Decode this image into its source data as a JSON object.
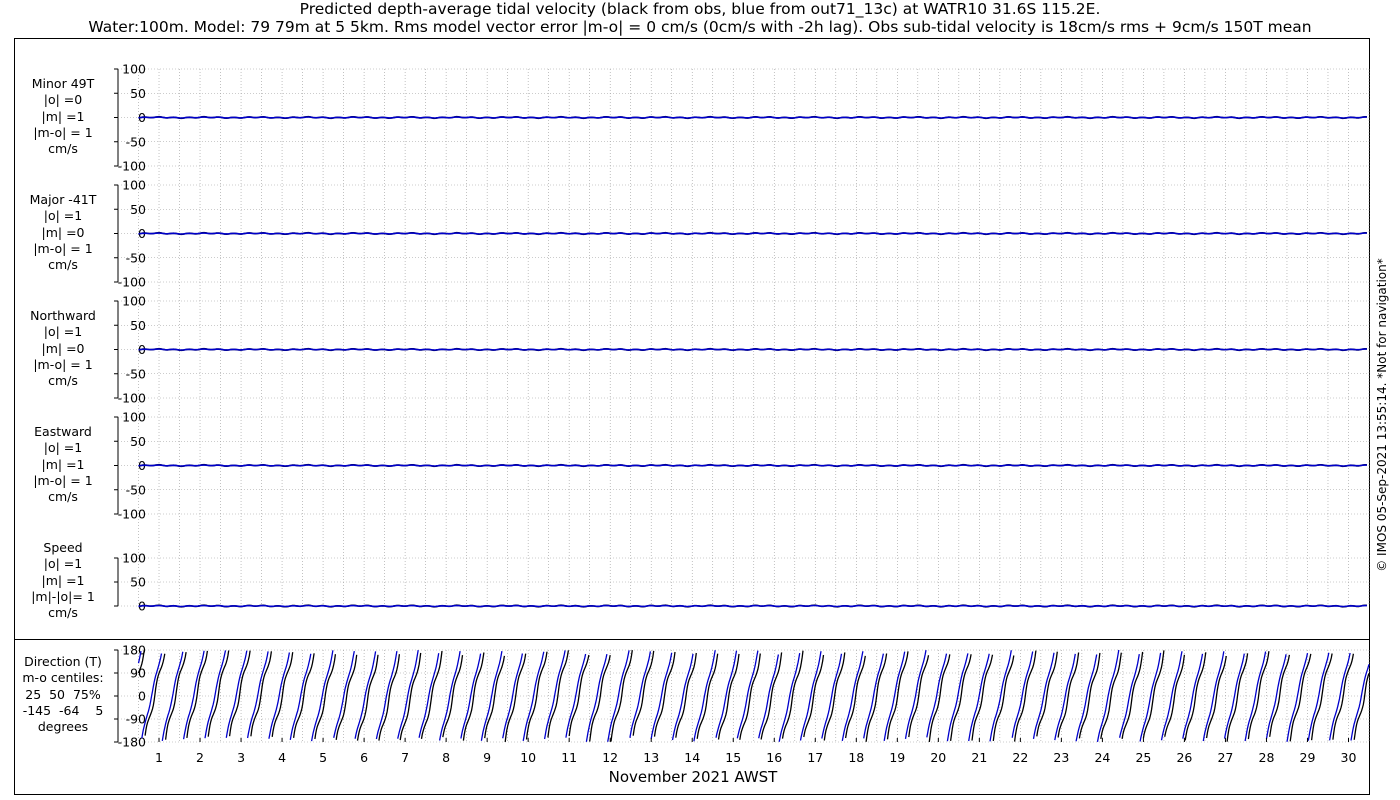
{
  "header": {
    "title_line1": "Predicted depth-average tidal velocity (black from obs, blue from out71_13c) at WATR10 31.6S 115.2E.",
    "title_line2": "Water:100m. Model: 79 79m at 5 5km. Rms model vector error |m-o| = 0 cm/s (0cm/s with -2h lag). Obs sub-tidal velocity is 18cm/s rms + 9cm/s 150T mean"
  },
  "credit": "© IMOS 05-Sep-2021 13:55:14. *Not for navigation*",
  "colors": {
    "obs": "#000000",
    "model": "#0000cc",
    "grid": "#9a9a9a"
  },
  "panels": [
    {
      "label": "Minor 49T\n|o| =0\n|m| =1\n|m-o| = 1\ncm/s"
    },
    {
      "label": "Major -41T\n|o| =1\n|m| =0\n|m-o| = 1\ncm/s"
    },
    {
      "label": "Northward\n|o| =1\n|m| =0\n|m-o| = 1\ncm/s"
    },
    {
      "label": "Eastward\n|o| =1\n|m| =1\n|m-o| = 1\ncm/s"
    },
    {
      "label": "Speed\n|o| =1\n|m| =1\n|m|-|o|= 1\ncm/s"
    },
    {
      "label": "Direction (T)\nm-o centiles:\n25  50  75%\n-145  -64    5\ndegrees"
    }
  ],
  "chart_data": [
    {
      "type": "line",
      "title": "Minor 49T",
      "ylim": [
        -100,
        100
      ],
      "yticks": [
        100,
        50,
        0,
        -50,
        -100
      ],
      "grid": true,
      "series": [
        {
          "name": "obs",
          "value_approx": 0
        },
        {
          "name": "model",
          "value_approx": 0
        }
      ]
    },
    {
      "type": "line",
      "title": "Major -41T",
      "ylim": [
        -100,
        100
      ],
      "yticks": [
        100,
        50,
        0,
        -50,
        -100
      ],
      "grid": true,
      "series": [
        {
          "name": "obs",
          "value_approx": 0
        },
        {
          "name": "model",
          "value_approx": 0
        }
      ]
    },
    {
      "type": "line",
      "title": "Northward",
      "ylim": [
        -100,
        100
      ],
      "yticks": [
        100,
        50,
        0,
        -50,
        -100
      ],
      "grid": true,
      "series": [
        {
          "name": "obs",
          "value_approx": 0
        },
        {
          "name": "model",
          "value_approx": 0
        }
      ]
    },
    {
      "type": "line",
      "title": "Eastward",
      "ylim": [
        -100,
        100
      ],
      "yticks": [
        100,
        50,
        0,
        -50,
        -100
      ],
      "grid": true,
      "series": [
        {
          "name": "obs",
          "value_approx": 0
        },
        {
          "name": "model",
          "value_approx": 0
        }
      ]
    },
    {
      "type": "line",
      "title": "Speed",
      "ylim": [
        0,
        100
      ],
      "yticks": [
        100,
        50,
        0
      ],
      "grid": true,
      "series": [
        {
          "name": "obs",
          "value_approx": 0
        },
        {
          "name": "model",
          "value_approx": 0
        }
      ]
    },
    {
      "type": "line",
      "title": "Direction (T)",
      "ylim": [
        -180,
        180
      ],
      "yticks": [
        180,
        90,
        0,
        -90,
        -180
      ],
      "grid": true,
      "xlabel": "November 2021 AWST",
      "xlim": [
        0,
        30.5
      ],
      "x_ticks": [
        "1",
        "2",
        "3",
        "4",
        "5",
        "6",
        "7",
        "8",
        "9",
        "10",
        "11",
        "12",
        "13",
        "14",
        "15",
        "16",
        "17",
        "18",
        "19",
        "20",
        "21",
        "22",
        "23",
        "24",
        "25",
        "26",
        "27",
        "28",
        "29",
        "30"
      ],
      "series": [
        {
          "name": "obs",
          "note_days": [
            0.5,
            30.5
          ],
          "approx_pattern": "semi-diurnal cycles, range about -180 to 180 degrees"
        },
        {
          "name": "model",
          "note_days": [
            0.5,
            30.5
          ],
          "approx_pattern": "semi-diurnal cycles, range about -180 to 180 degrees"
        }
      ]
    }
  ]
}
